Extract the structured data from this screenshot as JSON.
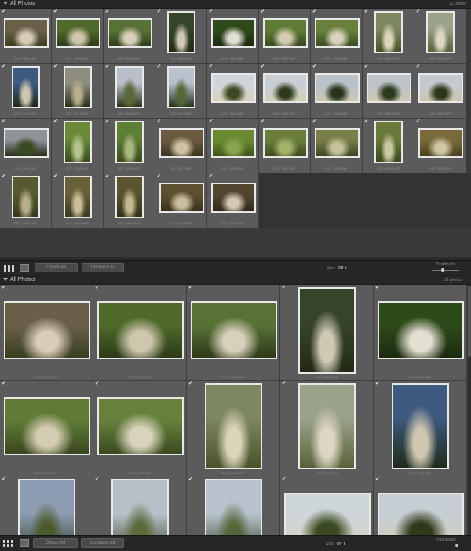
{
  "panel1": {
    "title": "All Photos",
    "count": "32 photos",
    "thumbs": [
      {
        "name": "DSC_0891.NEF",
        "o": "l",
        "c": [
          "#6a6048",
          "#d8cdb5",
          "#3a3d22"
        ]
      },
      {
        "name": "DSC_0896.NEF",
        "o": "l",
        "c": [
          "#4f6a2a",
          "#cfc6ae",
          "#2c3a18"
        ]
      },
      {
        "name": "DSC_0898.NEF",
        "o": "l",
        "c": [
          "#587236",
          "#d8d0bb",
          "#2e3a1a"
        ]
      },
      {
        "name": "DSC_0899.NEF",
        "o": "p",
        "c": [
          "#36452a",
          "#cfc9b4",
          "#232a17"
        ]
      },
      {
        "name": "DSC_0906.NEF",
        "o": "l",
        "c": [
          "#2f4a1a",
          "#e3dfd2",
          "#1c2a10"
        ]
      },
      {
        "name": "DSC_0907.NEF",
        "o": "l",
        "c": [
          "#5f7b36",
          "#d4ccb3",
          "#39471f"
        ]
      },
      {
        "name": "DSC_0908.NEF",
        "o": "l",
        "c": [
          "#67803c",
          "#d9d3bd",
          "#3a4a20"
        ]
      },
      {
        "name": "DSC_0909.NEF",
        "o": "p",
        "c": [
          "#7d8760",
          "#dcd4bb",
          "#4a5228"
        ]
      },
      {
        "name": "DSC_0910.NEF",
        "o": "p",
        "c": [
          "#9aa38a",
          "#ddd6c2",
          "#58623a"
        ]
      },
      {
        "name": "DSC_0911.NEF",
        "o": "p",
        "c": [
          "#3e5a7e",
          "#cfc6b0",
          "#1e2a1a"
        ]
      },
      {
        "name": "DSC_0913.NEF",
        "o": "p",
        "c": [
          "#8d8c7e",
          "#b6ae8c",
          "#2a3018"
        ]
      },
      {
        "name": "DSC_0914.NEF",
        "o": "p",
        "c": [
          "#b7c0c8",
          "#5a6a3a",
          "#2a3518"
        ]
      },
      {
        "name": "DSC_0915.NEF",
        "o": "p",
        "c": [
          "#b7c2cc",
          "#55683a",
          "#26321a"
        ]
      },
      {
        "name": "DSC_0916.NEF",
        "o": "l",
        "c": [
          "#cfd6da",
          "#3b4a22",
          "#d8d0ba"
        ]
      },
      {
        "name": "DSC_0917.NEF",
        "o": "l",
        "c": [
          "#c7cfd4",
          "#2e3a1a",
          "#d6cdb8"
        ]
      },
      {
        "name": "DSC_0918.NEF",
        "o": "l",
        "c": [
          "#b8c2c8",
          "#27341a",
          "#cfc6b0"
        ]
      },
      {
        "name": "DSC_0919.NEF",
        "o": "l",
        "c": [
          "#bcc4ca",
          "#2b3a1a",
          "#d0c8b2"
        ]
      },
      {
        "name": "DSC_0920.NEF",
        "o": "l",
        "c": [
          "#c4cad0",
          "#2a3618",
          "#ccc4ad"
        ]
      },
      {
        "name": "DSC_0923.NEF",
        "o": "l",
        "c": [
          "#8e949a",
          "#3a4a22",
          "#262d18"
        ]
      },
      {
        "name": "DSC_0925.NEF",
        "o": "p",
        "c": [
          "#6a8a3a",
          "#b6c38c",
          "#3a4a1c"
        ]
      },
      {
        "name": "DSC_0926.NEF",
        "o": "p",
        "c": [
          "#5f7f35",
          "#aab880",
          "#3a4a1c"
        ]
      },
      {
        "name": "DSC_0927.NEF",
        "o": "l",
        "c": [
          "#6a5a40",
          "#cfc3a4",
          "#3a3220"
        ]
      },
      {
        "name": "DSC_0928.NEF",
        "o": "l",
        "c": [
          "#6a8a32",
          "#8aa450",
          "#3e521c"
        ]
      },
      {
        "name": "DSC_0929.NEF",
        "o": "l",
        "c": [
          "#6a7e3c",
          "#a3b36a",
          "#3c4a1e"
        ]
      },
      {
        "name": "DSC_0930.NEF",
        "o": "l",
        "c": [
          "#7a7e4a",
          "#c6c29a",
          "#3e4420"
        ]
      },
      {
        "name": "DSC_0934.NEF",
        "o": "p",
        "c": [
          "#6a7a3a",
          "#c9c9a0",
          "#3c4820"
        ]
      },
      {
        "name": "DSC_0937.NEF",
        "o": "l",
        "c": [
          "#7a6a3a",
          "#cfc6a2",
          "#4a4020"
        ]
      },
      {
        "name": "DSC_0939.NEF",
        "o": "p",
        "c": [
          "#5a5a30",
          "#b8b08a",
          "#36381c"
        ]
      },
      {
        "name": "DSC_0940.NEF",
        "o": "p",
        "c": [
          "#6a6038",
          "#c8be98",
          "#3a3820"
        ]
      },
      {
        "name": "DSC_0941.NEF",
        "o": "p",
        "c": [
          "#5a5430",
          "#c2b890",
          "#343018"
        ]
      },
      {
        "name": "DSC_0942.NEF",
        "o": "l",
        "c": [
          "#5c5030",
          "#c9bd9c",
          "#38301c"
        ]
      },
      {
        "name": "DSC_0943.NEF",
        "o": "l",
        "c": [
          "#534630",
          "#d4c9b2",
          "#30281a"
        ]
      }
    ]
  },
  "panel2": {
    "title": "All Photos",
    "count": "32 photos",
    "thumbs": [
      {
        "name": "DSC_0891.NEF",
        "o": "l",
        "c": [
          "#6a6048",
          "#d8cdb5",
          "#3a3d22"
        ]
      },
      {
        "name": "DSC_0896.NEF",
        "o": "l",
        "c": [
          "#4f6a2a",
          "#cfc6ae",
          "#2c3a18"
        ]
      },
      {
        "name": "DSC_0898.NEF",
        "o": "l",
        "c": [
          "#587236",
          "#d8d0bb",
          "#2e3a1a"
        ]
      },
      {
        "name": "DSC_0899.NEF",
        "o": "p",
        "c": [
          "#36452a",
          "#cfc9b4",
          "#232a17"
        ]
      },
      {
        "name": "DSC_0906.NEF",
        "o": "l",
        "c": [
          "#2f4a1a",
          "#e3dfd2",
          "#1c2a10"
        ]
      },
      {
        "name": "DSC_0907.NEF",
        "o": "l",
        "c": [
          "#5f7b36",
          "#d4ccb3",
          "#39471f"
        ]
      },
      {
        "name": "DSC_0908.NEF",
        "o": "l",
        "c": [
          "#67803c",
          "#d9d3bd",
          "#3a4a20"
        ]
      },
      {
        "name": "DSC_0909.NEF",
        "o": "p",
        "c": [
          "#7d8760",
          "#dcd4bb",
          "#4a5228"
        ]
      },
      {
        "name": "DSC_0910.NEF",
        "o": "p",
        "c": [
          "#9aa38a",
          "#ddd6c2",
          "#58623a"
        ]
      },
      {
        "name": "DSC_0911.NEF",
        "o": "p",
        "c": [
          "#3e5a7e",
          "#cfc6b0",
          "#1e2a1a"
        ]
      },
      {
        "name": "DSC_0913.NEF",
        "o": "p",
        "c": [
          "#8d9cb0",
          "#4a5a2a",
          "#22301a"
        ]
      },
      {
        "name": "DSC_0914.NEF",
        "o": "p",
        "c": [
          "#b7c0c8",
          "#5a6a3a",
          "#2a3518"
        ]
      },
      {
        "name": "DSC_0915.NEF",
        "o": "p",
        "c": [
          "#b7c2cc",
          "#55683a",
          "#26321a"
        ]
      },
      {
        "name": "DSC_0916.NEF",
        "o": "l",
        "c": [
          "#cfd6da",
          "#3b4a22",
          "#d8d0ba"
        ]
      },
      {
        "name": "DSC_0917.NEF",
        "o": "l",
        "c": [
          "#c7cfd4",
          "#2e3a1a",
          "#d6cdb8"
        ]
      }
    ]
  },
  "toolbar1": {
    "check_all": "Check All",
    "uncheck_all": "Uncheck All",
    "sort_label": "Sort:",
    "sort_value": "Off",
    "thumbnails_label": "Thumbnails"
  },
  "toolbar2": {
    "check_all": "Check All",
    "uncheck_all": "Uncheck All",
    "sort_label": "Sort:",
    "sort_value": "Off",
    "thumbnails_label": "Thumbnails"
  },
  "checkmark": "✔"
}
